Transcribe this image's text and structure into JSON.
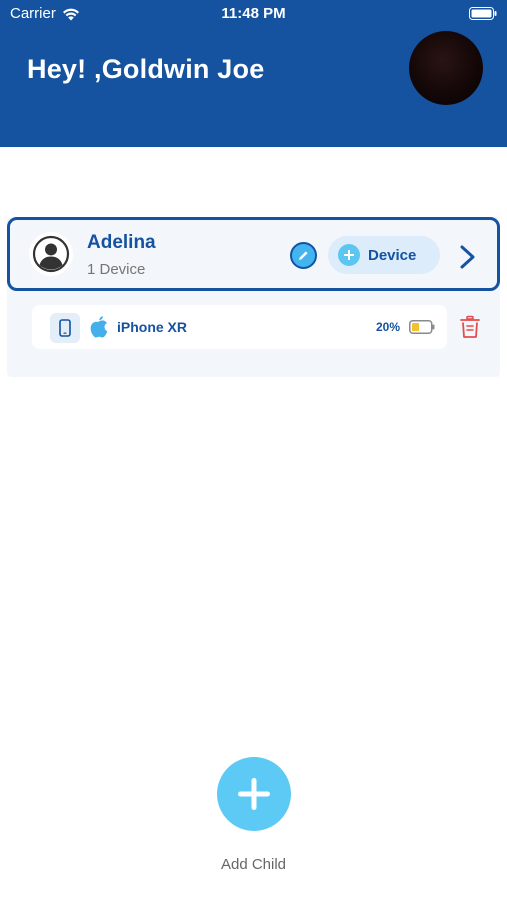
{
  "status_bar": {
    "carrier": "Carrier",
    "time": "11:48 PM"
  },
  "header": {
    "greeting": "Hey! ,Goldwin Joe",
    "background_color": "#1552a0"
  },
  "children": [
    {
      "name": "Adelina",
      "device_count_label": "1 Device",
      "add_device_label": "Device",
      "devices": [
        {
          "name": "iPhone XR",
          "platform_icon": "apple-icon",
          "battery_label": "20%",
          "battery_level": 0.2
        }
      ]
    }
  ],
  "add_child": {
    "label": "Add Child",
    "button_color": "#5ccaf5"
  },
  "colors": {
    "primary": "#1552a0",
    "accent": "#5cc6f3",
    "delete": "#e74c4c"
  }
}
